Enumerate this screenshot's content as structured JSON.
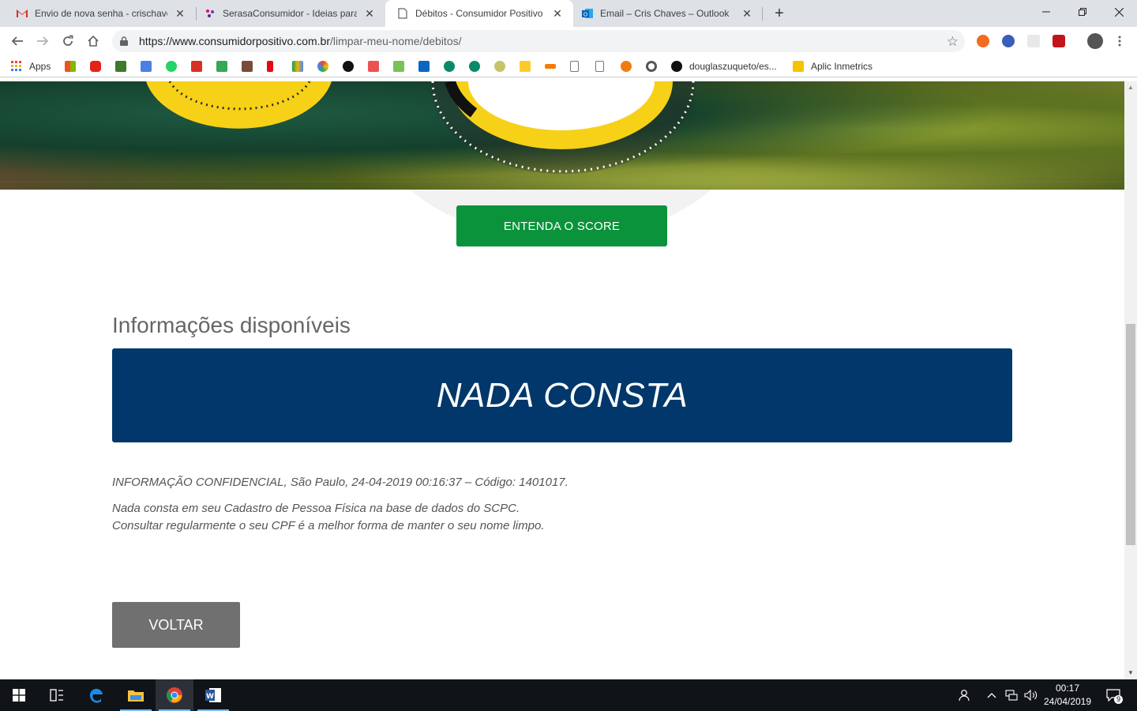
{
  "browser": {
    "tabs": [
      {
        "title": "Envio de nova senha - crischaves",
        "icon": "gmail-icon",
        "active": false
      },
      {
        "title": "SerasaConsumidor - Ideias para f",
        "icon": "serasa-icon",
        "active": false
      },
      {
        "title": "Débitos - Consumidor Positivo B",
        "icon": "page-icon",
        "active": true
      },
      {
        "title": "Email – Cris Chaves – Outlook",
        "icon": "outlook-icon",
        "active": false
      }
    ],
    "close_glyph": "✕",
    "new_tab_glyph": "+",
    "url_host": "https://www.consumidorpositivo.com.br",
    "url_path": "/limpar-meu-nome/debitos/",
    "bookmarks": {
      "apps_label": "Apps",
      "github_label": "douglaszuqueto/es...",
      "inmetrics_label": "Aplic Inmetrics"
    }
  },
  "page": {
    "entenda_button": "ENTENDA O SCORE",
    "section_title": "Informações disponíveis",
    "result_banner": "NADA CONSTA",
    "confidential_line": "INFORMAÇÃO CONFIDENCIAL, São Paulo, 24-04-2019 00:16:37 – Código: 1401017.",
    "message_line_1": "Nada consta em seu Cadastro de Pessoa Física na base de dados do SCPC.",
    "message_line_2": "Consultar regularmente o seu CPF é a melhor forma de manter o seu nome limpo.",
    "voltar_button": "VOLTAR",
    "colors": {
      "green_button": "#0a933b",
      "banner_blue": "#01376a",
      "voltar_gray": "#707070",
      "score_yellow": "#f7d117"
    }
  },
  "taskbar": {
    "time": "00:17",
    "date": "24/04/2019",
    "notification_count": "9",
    "apps": [
      "start-icon",
      "task-view-icon",
      "edge-icon",
      "file-explorer-icon",
      "chrome-icon",
      "word-icon"
    ]
  }
}
